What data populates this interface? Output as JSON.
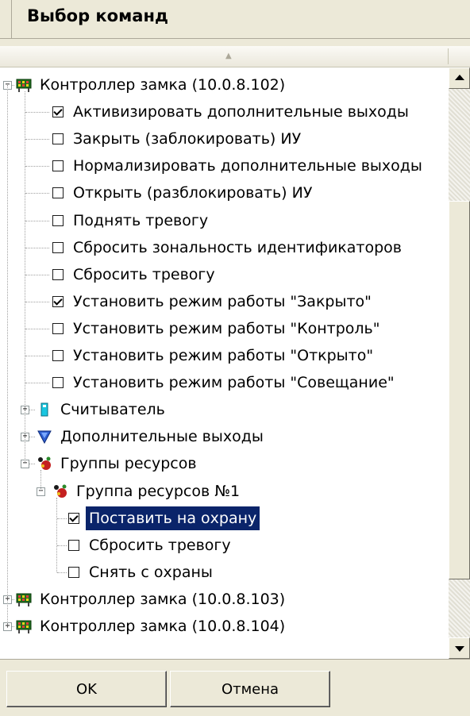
{
  "title": "Выбор команд",
  "tree": [
    {
      "type": "node",
      "label": "Контроллер замка (10.0.8.102)",
      "icon": "controller-icon",
      "expanded": true
    },
    {
      "type": "cmd",
      "label": "Активизировать дополнительные выходы",
      "checked": true
    },
    {
      "type": "cmd",
      "label": "Закрыть (заблокировать) ИУ",
      "checked": false
    },
    {
      "type": "cmd",
      "label": "Нормализировать дополнительные выходы",
      "checked": false
    },
    {
      "type": "cmd",
      "label": "Открыть (разблокировать) ИУ",
      "checked": false
    },
    {
      "type": "cmd",
      "label": "Поднять тревогу",
      "checked": false
    },
    {
      "type": "cmd",
      "label": "Сбросить зональность идентификаторов",
      "checked": false
    },
    {
      "type": "cmd",
      "label": "Сбросить тревогу",
      "checked": false
    },
    {
      "type": "cmd",
      "label": "Установить режим работы \"Закрыто\"",
      "checked": true
    },
    {
      "type": "cmd",
      "label": "Установить режим работы \"Контроль\"",
      "checked": false
    },
    {
      "type": "cmd",
      "label": "Установить режим работы \"Открыто\"",
      "checked": false
    },
    {
      "type": "cmd",
      "label": "Установить режим работы \"Совещание\"",
      "checked": false
    },
    {
      "type": "node",
      "label": "Считыватель",
      "icon": "reader-icon",
      "expanded": false
    },
    {
      "type": "node",
      "label": "Дополнительные выходы",
      "icon": "outputs-icon",
      "expanded": false
    },
    {
      "type": "node",
      "label": "Группы ресурсов",
      "icon": "resource-group-icon",
      "expanded": true
    },
    {
      "type": "node",
      "label": "Группа ресурсов №1",
      "icon": "resource-group-icon",
      "expanded": true
    },
    {
      "type": "cmd",
      "label": "Поставить на охрану",
      "checked": true,
      "selected": true
    },
    {
      "type": "cmd",
      "label": "Сбросить тревогу",
      "checked": false
    },
    {
      "type": "cmd",
      "label": "Снять с охраны",
      "checked": false
    },
    {
      "type": "node",
      "label": "Контроллер замка (10.0.8.103)",
      "icon": "controller-icon",
      "expanded": false
    },
    {
      "type": "node",
      "label": "Контроллер замка (10.0.8.104)",
      "icon": "controller-icon",
      "expanded": false
    }
  ],
  "scroll_position": 0.18,
  "buttons": {
    "ok": "OK",
    "cancel": "Отмена"
  }
}
